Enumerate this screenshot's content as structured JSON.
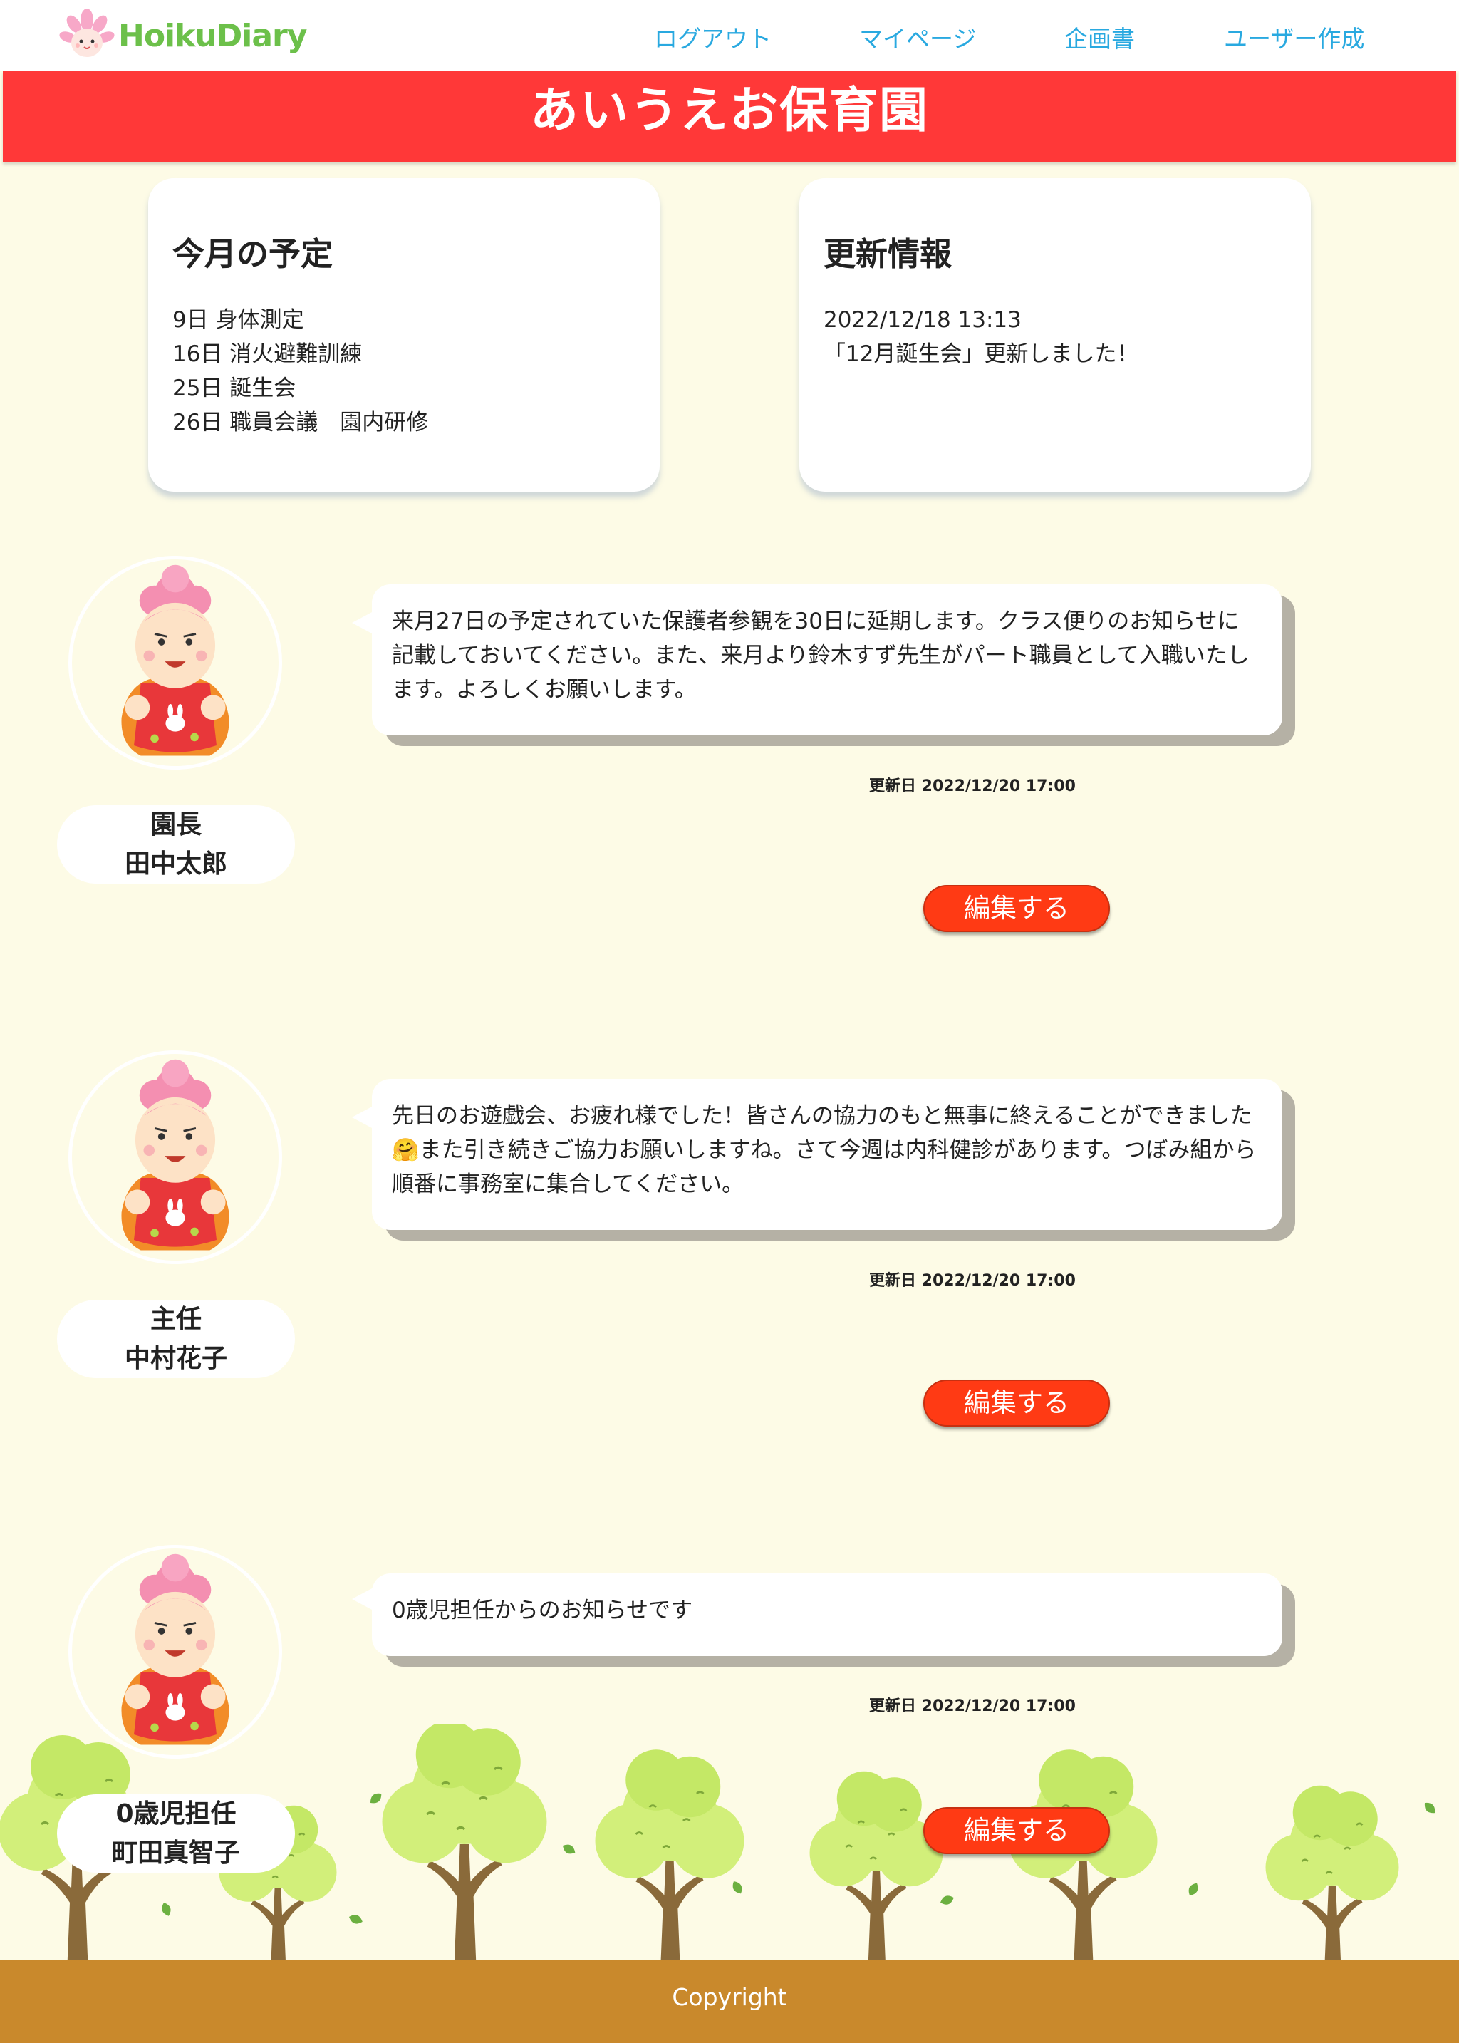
{
  "app": {
    "logo_text": "HoikuDiary"
  },
  "nav": {
    "logout": "ログアウト",
    "mypage": "マイページ",
    "plan": "企画書",
    "create_user": "ユーザー作成"
  },
  "title": "あいうえお保育園",
  "schedule": {
    "heading": "今月の予定",
    "items": [
      "9日 身体測定",
      "16日 消火避難訓練",
      "25日 誕生会",
      "26日 職員会議　園内研修"
    ]
  },
  "updates": {
    "heading": "更新情報",
    "items": [
      "2022/12/18 13:13",
      "「12月誕生会」更新しました！"
    ]
  },
  "posts": [
    {
      "role": "園長",
      "name": "田中太郎",
      "message": "来月27日の予定されていた保護者参観を30日に延期します。クラス便りのお知らせに記載しておいてください。また、来月より鈴木すず先生がパート職員として入職いたします。よろしくお願いします。",
      "updated": "更新日 2022/12/20 17:00",
      "edit_label": "編集する"
    },
    {
      "role": "主任",
      "name": "中村花子",
      "message": "先日のお遊戯会、お疲れ様でした！皆さんの協力のもと無事に終えることができました🤗また引き続きご協力お願いしますね。さて今週は内科健診があります。つぼみ組から順番に事務室に集合してください。",
      "updated": "更新日 2022/12/20 17:00",
      "edit_label": "編集する"
    },
    {
      "role": "0歳児担任",
      "name": "町田真智子",
      "message": "0歳児担任からのお知らせです",
      "updated": "更新日 2022/12/20 17:00",
      "edit_label": "編集する"
    }
  ],
  "footer": {
    "copyright": "Copyright"
  },
  "colors": {
    "title_bar": "#ff3838",
    "nav_link": "#29a9e0",
    "edit_button": "#ff3a14",
    "footer": "#c9892c",
    "background": "#fdfbe6",
    "logo_text": "#6cc04a"
  },
  "icons": [
    "flower-logo-icon",
    "teacher-avatar-icon",
    "tree-icon",
    "leaf-icon"
  ]
}
